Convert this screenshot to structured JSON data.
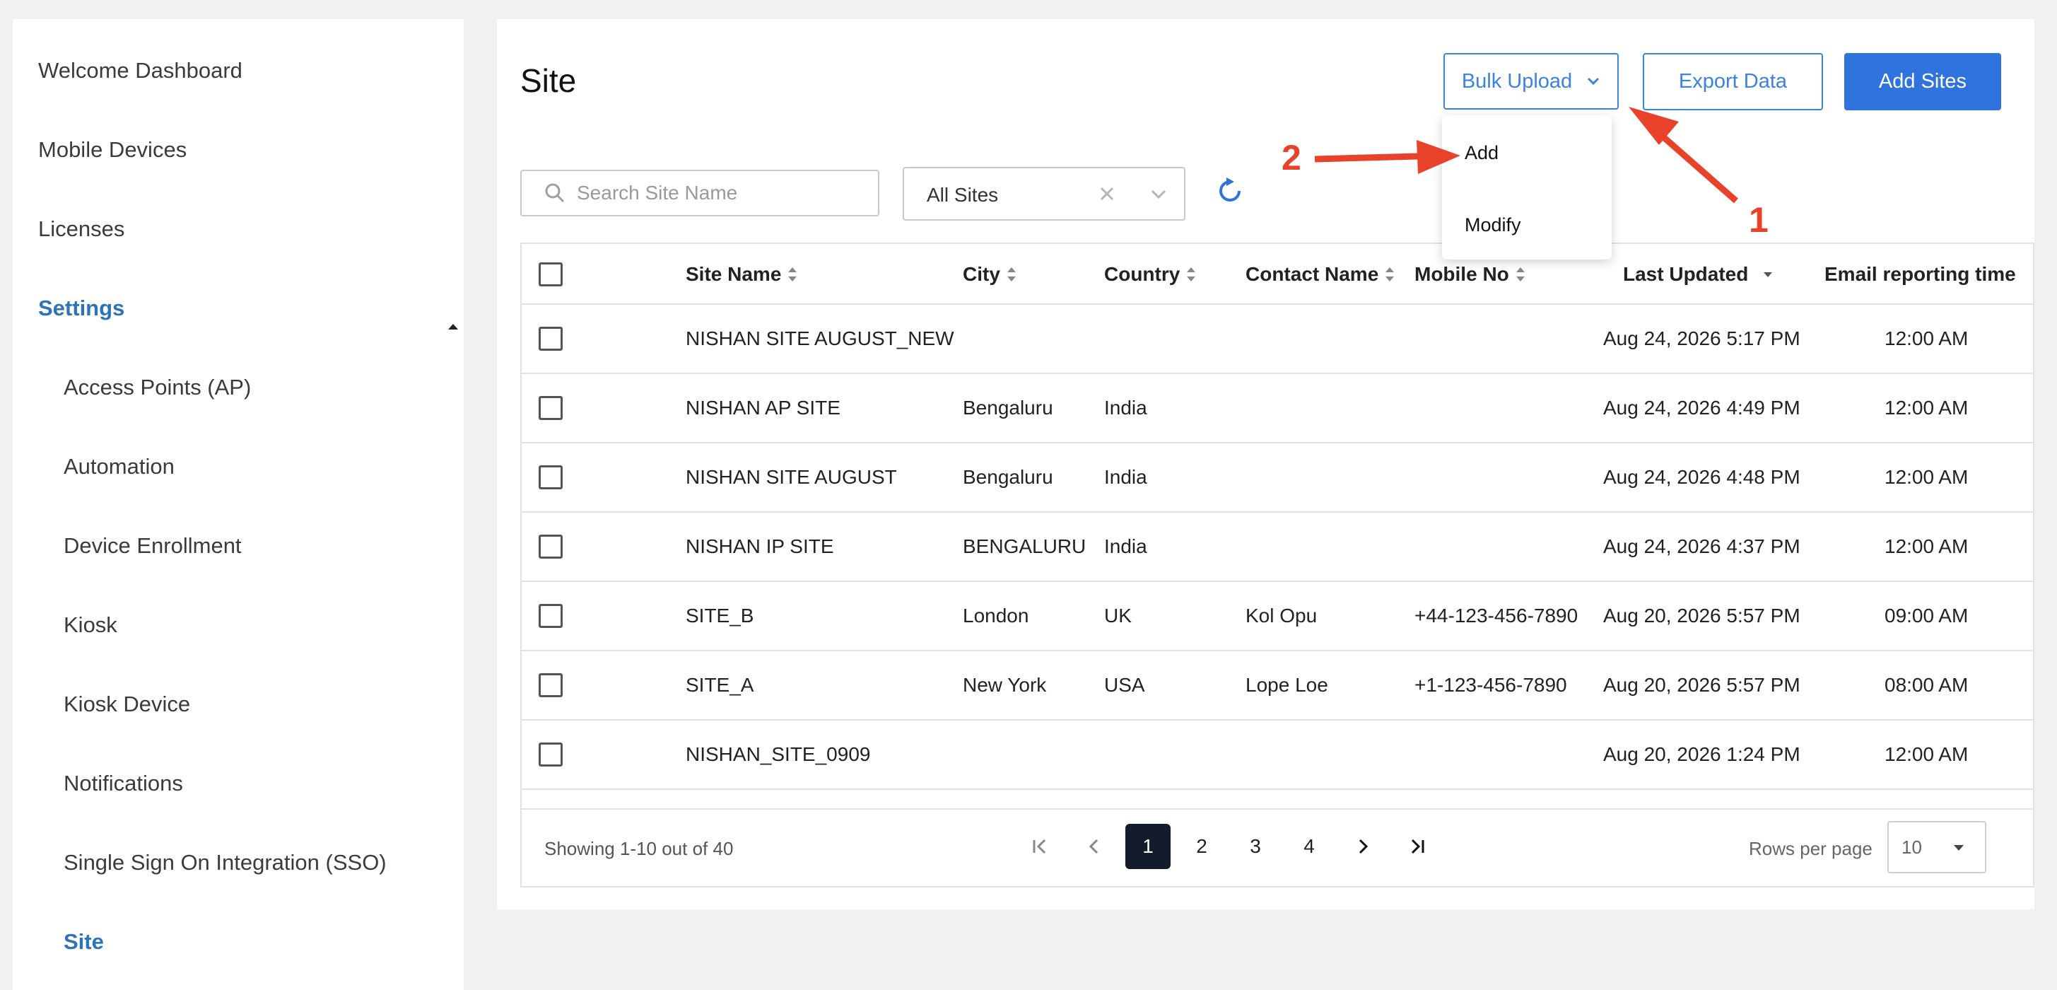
{
  "sidebar": {
    "items": [
      {
        "label": "Welcome Dashboard"
      },
      {
        "label": "Mobile Devices"
      },
      {
        "label": "Licenses"
      },
      {
        "label": "Settings"
      }
    ],
    "sub_items": [
      {
        "label": "Access Points (AP)"
      },
      {
        "label": "Automation"
      },
      {
        "label": "Device Enrollment"
      },
      {
        "label": "Kiosk"
      },
      {
        "label": "Kiosk Device"
      },
      {
        "label": "Notifications"
      },
      {
        "label": "Single Sign On Integration (SSO)"
      },
      {
        "label": "Site"
      }
    ]
  },
  "header": {
    "title": "Site",
    "bulk_upload_label": "Bulk Upload",
    "export_label": "Export Data",
    "add_sites_label": "Add Sites"
  },
  "bulk_menu": {
    "items": [
      {
        "label": "Add"
      },
      {
        "label": "Modify"
      }
    ]
  },
  "toolbar": {
    "search_placeholder": "Search Site Name",
    "site_filter_value": "All Sites"
  },
  "table": {
    "columns": [
      {
        "label": "Site Name"
      },
      {
        "label": "City"
      },
      {
        "label": "Country"
      },
      {
        "label": "Contact Name"
      },
      {
        "label": "Mobile No"
      },
      {
        "label": "Last Updated"
      },
      {
        "label": "Email reporting time"
      }
    ],
    "rows": [
      {
        "site": "NISHAN SITE AUGUST_NEW",
        "city": "",
        "country": "",
        "contact": "",
        "mobile": "",
        "updated": "Aug 24, 2026 5:17 PM",
        "email_time": "12:00 AM"
      },
      {
        "site": "NISHAN AP SITE",
        "city": "Bengaluru",
        "country": "India",
        "contact": "",
        "mobile": "",
        "updated": "Aug 24, 2026 4:49 PM",
        "email_time": "12:00 AM"
      },
      {
        "site": "NISHAN SITE AUGUST",
        "city": "Bengaluru",
        "country": "India",
        "contact": "",
        "mobile": "",
        "updated": "Aug 24, 2026 4:48 PM",
        "email_time": "12:00 AM"
      },
      {
        "site": "NISHAN IP SITE",
        "city": "BENGALURU",
        "country": "India",
        "contact": "",
        "mobile": "",
        "updated": "Aug 24, 2026 4:37 PM",
        "email_time": "12:00 AM"
      },
      {
        "site": "SITE_B",
        "city": "London",
        "country": "UK",
        "contact": "Kol Opu",
        "mobile": "+44-123-456-7890",
        "updated": "Aug 20, 2026 5:57 PM",
        "email_time": "09:00 AM"
      },
      {
        "site": "SITE_A",
        "city": "New York",
        "country": "USA",
        "contact": "Lope Loe",
        "mobile": "+1-123-456-7890",
        "updated": "Aug 20, 2026 5:57 PM",
        "email_time": "08:00 AM"
      },
      {
        "site": "NISHAN_SITE_0909",
        "city": "",
        "country": "",
        "contact": "",
        "mobile": "",
        "updated": "Aug 20, 2026 1:24 PM",
        "email_time": "12:00 AM"
      }
    ]
  },
  "pagination": {
    "showing_text": "Showing 1-10 out of 40",
    "pages": [
      "1",
      "2",
      "3",
      "4"
    ],
    "current_page": "1",
    "rows_per_page_label": "Rows per page",
    "rows_per_page_value": "10"
  },
  "annotations": {
    "label_1": "1",
    "label_2": "2",
    "color": "#e8432a"
  },
  "colors": {
    "accent": "#2f74de",
    "sidebar_active": "#2c73b8",
    "current_page": "#141b2d"
  }
}
